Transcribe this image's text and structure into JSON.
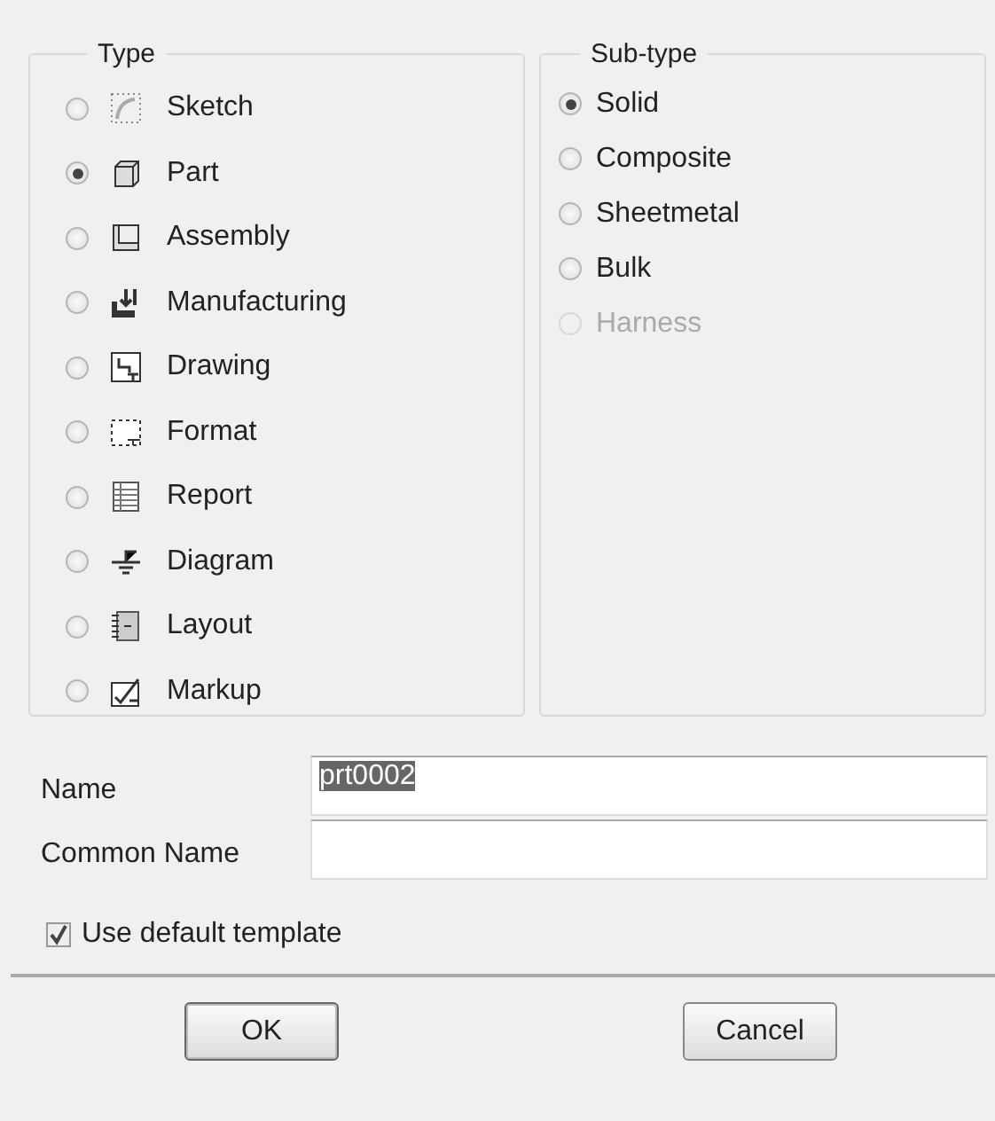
{
  "type_group": {
    "title": "Type",
    "items": [
      {
        "label": "Sketch",
        "selected": false
      },
      {
        "label": "Part",
        "selected": true
      },
      {
        "label": "Assembly",
        "selected": false
      },
      {
        "label": "Manufacturing",
        "selected": false
      },
      {
        "label": "Drawing",
        "selected": false
      },
      {
        "label": "Format",
        "selected": false
      },
      {
        "label": "Report",
        "selected": false
      },
      {
        "label": "Diagram",
        "selected": false
      },
      {
        "label": "Layout",
        "selected": false
      },
      {
        "label": "Markup",
        "selected": false
      }
    ]
  },
  "subtype_group": {
    "title": "Sub-type",
    "items": [
      {
        "label": "Solid",
        "selected": true,
        "disabled": false
      },
      {
        "label": "Composite",
        "selected": false,
        "disabled": false
      },
      {
        "label": "Sheetmetal",
        "selected": false,
        "disabled": false
      },
      {
        "label": "Bulk",
        "selected": false,
        "disabled": false
      },
      {
        "label": "Harness",
        "selected": false,
        "disabled": true
      }
    ]
  },
  "fields": [
    {
      "label": "Name",
      "value": "prt0002",
      "highlighted": true
    },
    {
      "label": "Common Name"
    }
  ],
  "use_default_template": {
    "label": "Use default template",
    "checked": true
  },
  "buttons": [
    "OK",
    "Cancel"
  ]
}
